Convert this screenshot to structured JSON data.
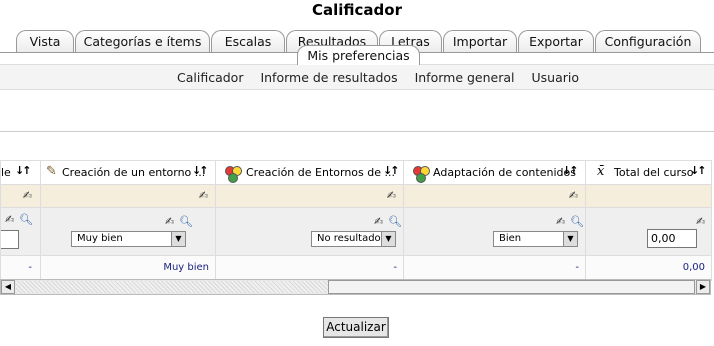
{
  "page": {
    "title": "Calificador"
  },
  "tabs": [
    {
      "label": "Vista"
    },
    {
      "label": "Categorías e ítems"
    },
    {
      "label": "Escalas"
    },
    {
      "label": "Resultados"
    },
    {
      "label": "Letras"
    },
    {
      "label": "Importar"
    },
    {
      "label": "Exportar"
    },
    {
      "label": "Configuración"
    },
    {
      "label": "Mis preferencias"
    }
  ],
  "subnav": {
    "links": [
      "Calificador",
      "Informe de resultados",
      "Informe general",
      "Usuario"
    ]
  },
  "grid": {
    "columns": [
      {
        "header": "le",
        "select_value": "",
        "average": "-"
      },
      {
        "header": "Creación de un entorno ...",
        "select_value": "Muy bien",
        "average": "Muy bien"
      },
      {
        "header": "Creación de Entornos de ...",
        "select_value": "No resultado",
        "average": "-"
      },
      {
        "header": "Adaptación de contenidos",
        "select_value": "Bien",
        "average": "-"
      },
      {
        "header": "Total del curso",
        "input_value": "0,00",
        "average": "0,00"
      }
    ],
    "sort_icon": "sort-arrows-icon",
    "edit_icon": "edit-pencil-icon",
    "zoom_icon": "magnifier-icon"
  },
  "buttons": {
    "update": "Actualizar"
  }
}
